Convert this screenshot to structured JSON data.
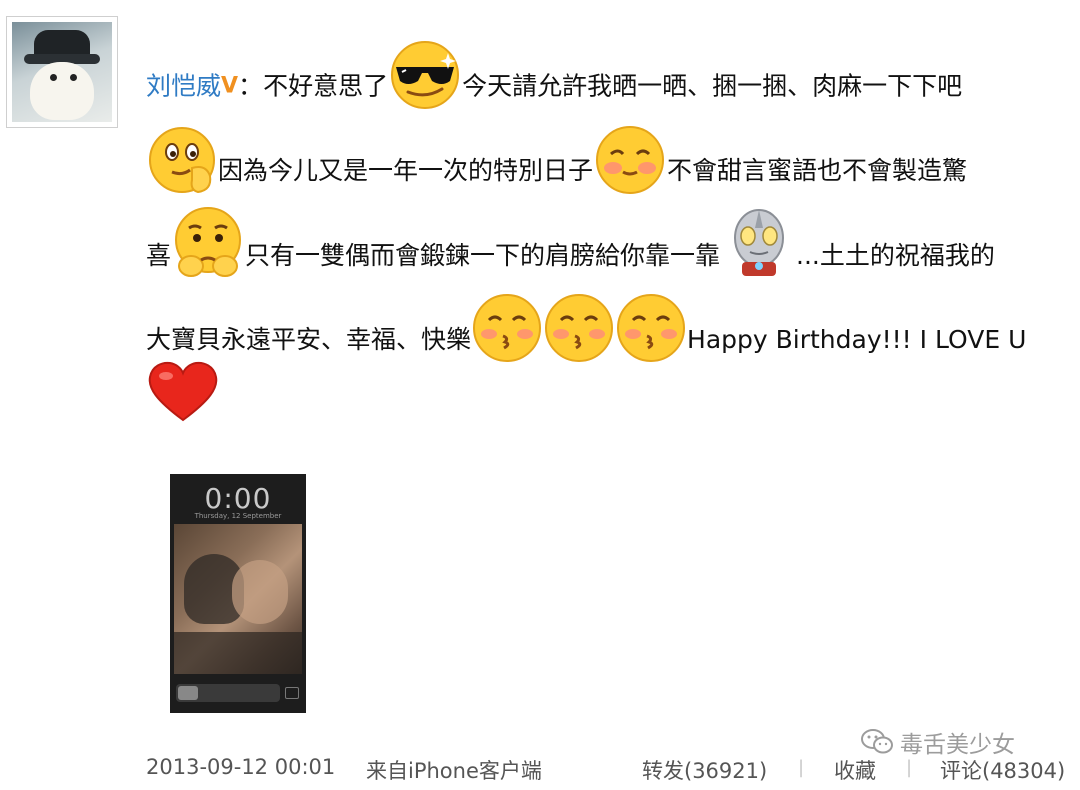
{
  "post": {
    "author": "刘恺威",
    "vip_mark": "V",
    "colon": "：",
    "text": {
      "s1": "不好意思了",
      "s2": "今天請允許我晒一晒、捆一捆、肉麻一下下吧",
      "s3": "因為今儿又是一年一次的特別日子",
      "s4": "不會甜言蜜語也不會製造驚",
      "s5": "喜",
      "s6": "只有一雙偶而會鍛鍊一下的肩膀給你靠一靠",
      "s7": "...土土的祝福我的",
      "s8": "大寶貝永遠平安、幸福、快樂",
      "s9": "Happy Birthday!!! I LOVE U"
    },
    "emojis": [
      "cool-sunglasses",
      "thinking",
      "shy-blush",
      "worried",
      "ultraman",
      "kiss",
      "kiss",
      "kiss",
      "red-heart"
    ],
    "attached_image": {
      "clock": "0:00",
      "date": "Thursday, 12 September"
    }
  },
  "footer": {
    "timestamp": "2013-09-12 00:01",
    "source": "来自iPhone客户端",
    "repost": "转发(36921)",
    "favorite": "收藏",
    "comment": "评论(48304)",
    "separator": "|"
  },
  "watermark": {
    "text": "毒舌美少女",
    "icon": "wechat-icon"
  },
  "colors": {
    "author": "#2f7bc4",
    "vip": "#f09020",
    "footer_text": "#555555",
    "watermark": "#9c9c9c"
  }
}
